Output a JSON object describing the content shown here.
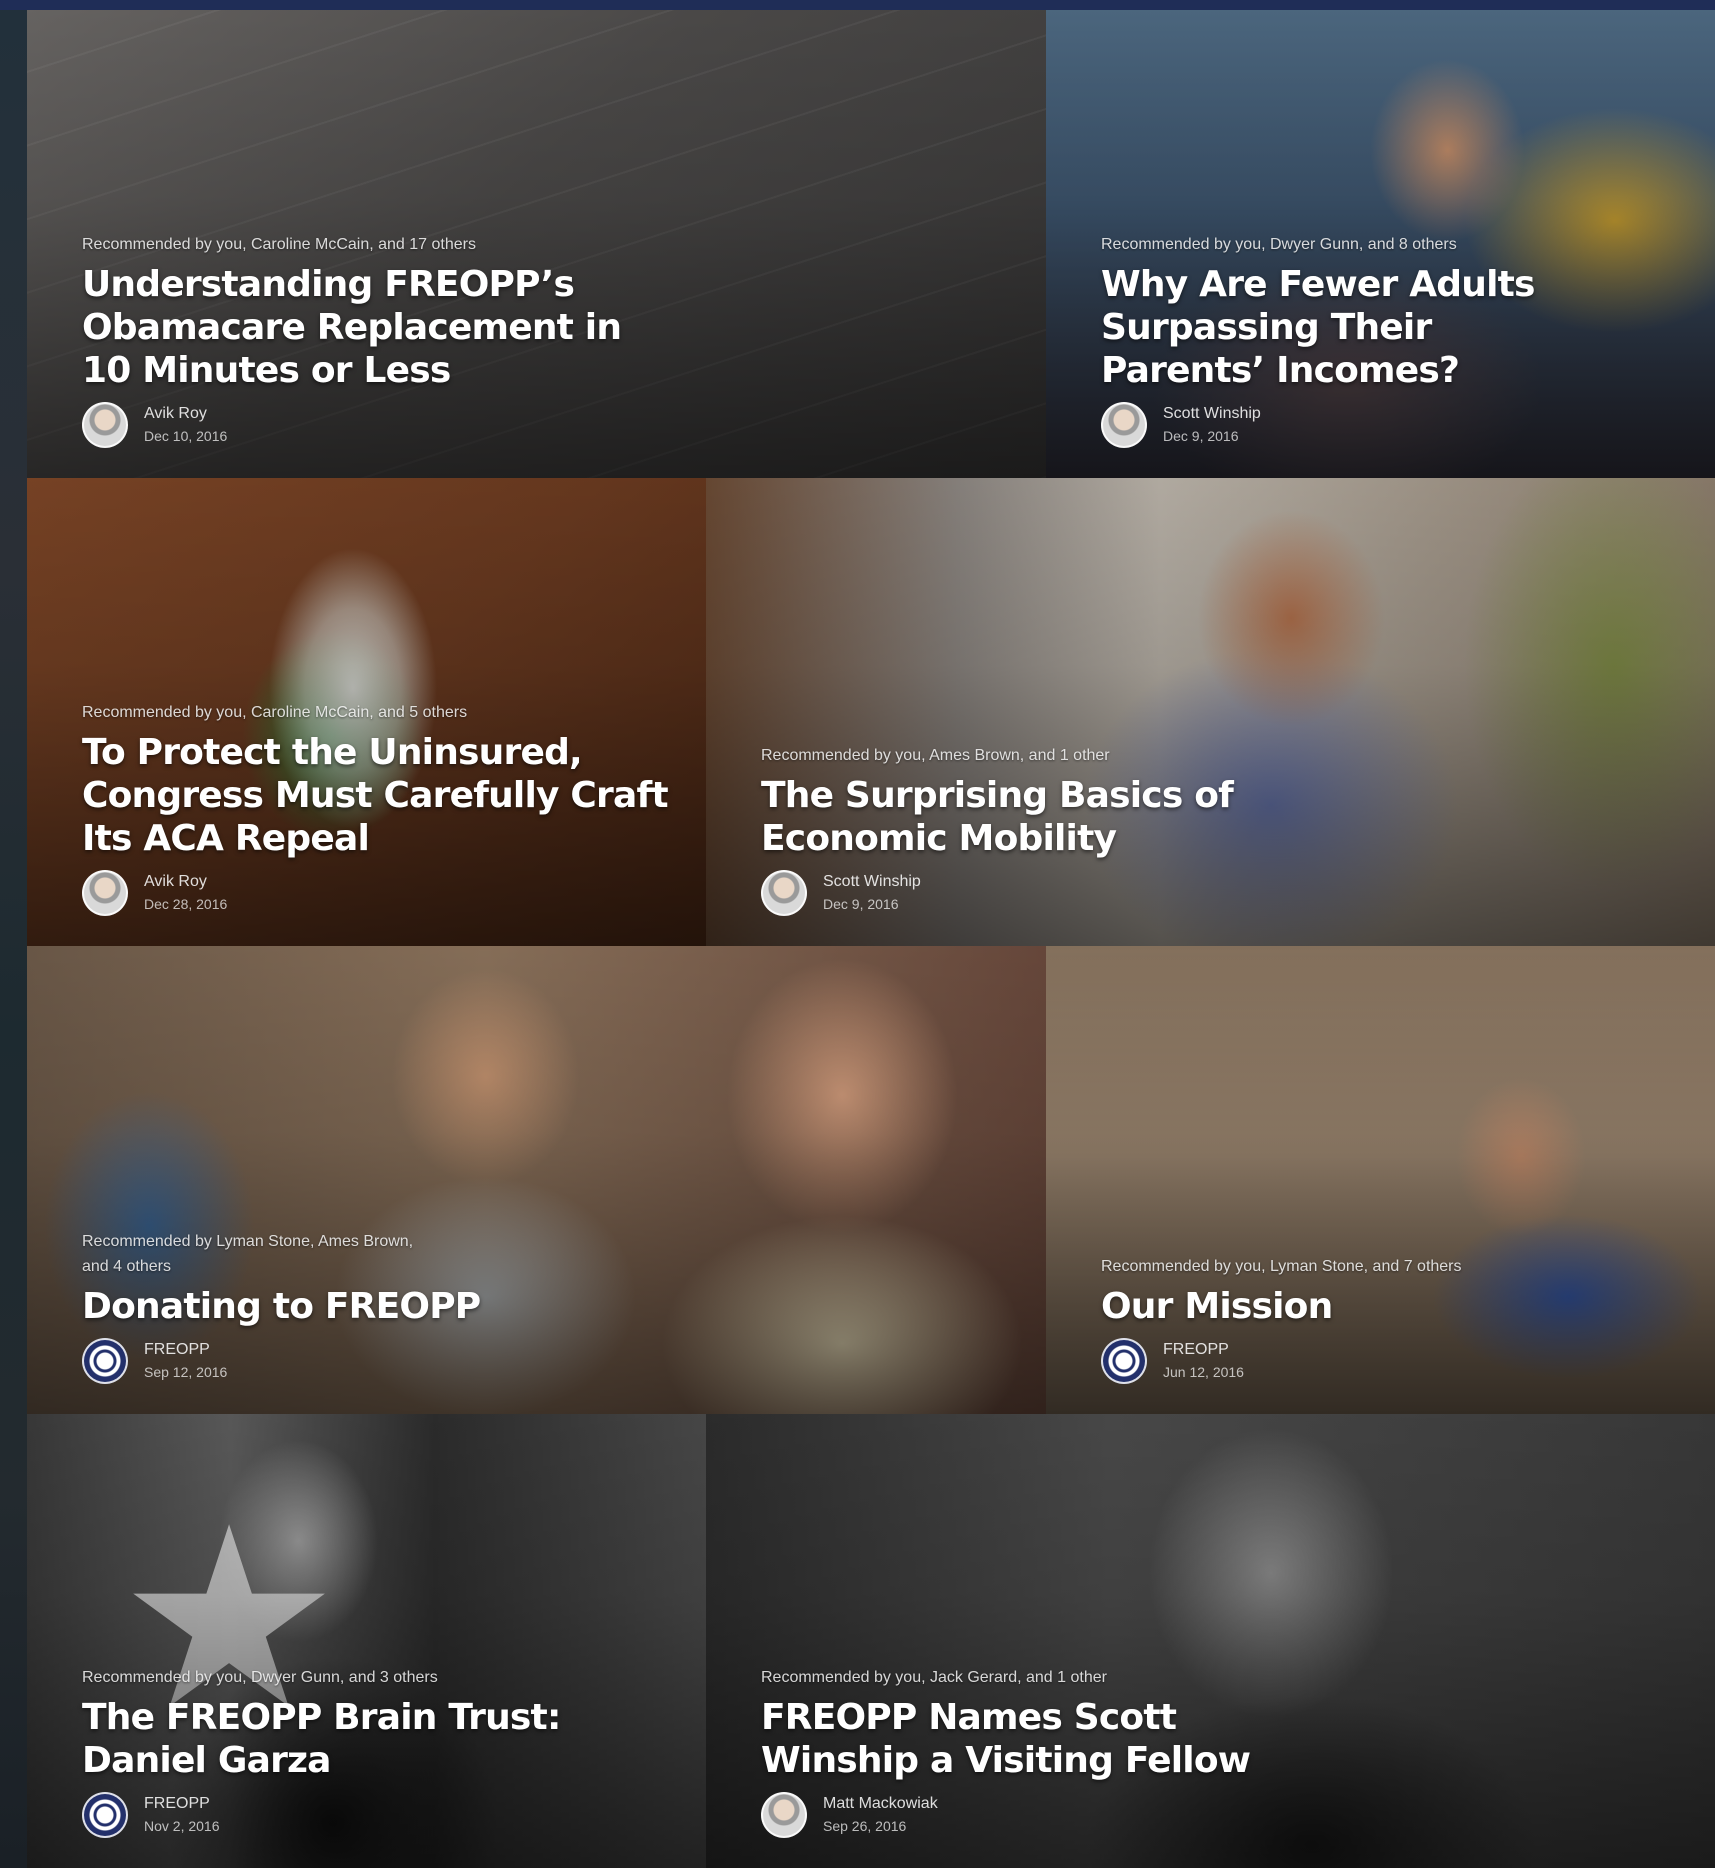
{
  "cards": [
    {
      "recommended": "Recommended by you, Caroline McCain, and 17 others",
      "title_lines": [
        "Understanding FREOPP’s",
        "Obamacare Replacement in",
        "10 Minutes or Less"
      ],
      "author": "Avik Roy",
      "date": "Dec 10, 2016",
      "avatar": "person-avatar"
    },
    {
      "recommended": "Recommended by you, Dwyer Gunn, and 8 others",
      "title_lines": [
        "Why Are Fewer Adults",
        "Surpassing Their",
        "Parents’ Incomes?"
      ],
      "author": "Scott Winship",
      "date": "Dec 9, 2016",
      "avatar": "person-avatar"
    },
    {
      "recommended": "Recommended by you, Caroline McCain, and 5 others",
      "title_lines": [
        "To Protect the Uninsured,",
        "Congress Must Carefully Craft",
        "Its ACA Repeal"
      ],
      "author": "Avik Roy",
      "date": "Dec 28, 2016",
      "avatar": "person-avatar"
    },
    {
      "recommended": "Recommended by you, Ames Brown, and 1 other",
      "title_lines": [
        "The Surprising Basics of",
        "Economic Mobility"
      ],
      "author": "Scott Winship",
      "date": "Dec 9, 2016",
      "avatar": "person-avatar"
    },
    {
      "recommended_lines": [
        "Recommended by Lyman Stone, Ames Brown,",
        "and 4 others"
      ],
      "title_lines": [
        "Donating to FREOPP"
      ],
      "author": "FREOPP",
      "date": "Sep 12, 2016",
      "avatar": "freopp-logo-avatar"
    },
    {
      "recommended": "Recommended by you, Lyman Stone, and 7 others",
      "title_lines": [
        "Our Mission"
      ],
      "author": "FREOPP",
      "date": "Jun 12, 2016",
      "avatar": "freopp-logo-avatar"
    },
    {
      "recommended": "Recommended by you, Dwyer Gunn, and 3 others",
      "title_lines": [
        "The FREOPP Brain Trust:",
        "Daniel Garza"
      ],
      "author": "FREOPP",
      "date": "Nov 2, 2016",
      "avatar": "freopp-logo-avatar"
    },
    {
      "recommended": "Recommended by you, Jack Gerard, and 1 other",
      "title_lines": [
        "FREOPP Names Scott",
        "Winship a Visiting Fellow"
      ],
      "author": "Matt Mackowiak",
      "date": "Sep 26, 2016",
      "avatar": "person-avatar"
    }
  ],
  "colors": {
    "top_bar": "#1f2d57",
    "freopp_blue": "#23306b"
  }
}
